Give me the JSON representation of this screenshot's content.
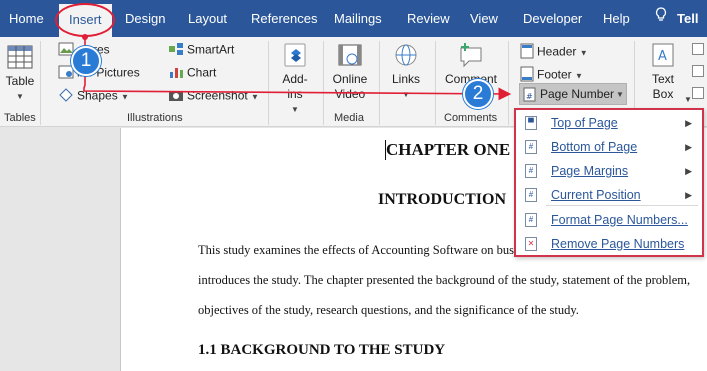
{
  "tabs": [
    "Home",
    "Insert",
    "Design",
    "Layout",
    "References",
    "Mailings",
    "Review",
    "View",
    "Developer",
    "Help"
  ],
  "active_tab": "Insert",
  "tell_me": "Tell m",
  "ribbon": {
    "table_label": "Table",
    "tables_group": "Tables",
    "illustrations": {
      "pictures": "ctures",
      "online_pictures": "ine Pictures",
      "shapes": "Shapes",
      "smartart": "SmartArt",
      "chart": "Chart",
      "screenshot": "Screenshot",
      "group": "Illustrations"
    },
    "addins": "Add-ins",
    "online_video": "Online Video",
    "media_group": "Media",
    "links": "Links",
    "comment": "Comment",
    "comments_group": "Comments",
    "header": "Header",
    "footer": "Footer",
    "page_number": "Page Number",
    "textbox": "Text Box"
  },
  "document": {
    "chapter_title": "CHAPTER ONE",
    "intro_title": "INTRODUCTION",
    "para_lines": [
      "This study examines the effects of Accounting Software on bus",
      "introduces the study. The chapter presented the background of the study, statement of the problem,",
      "objectives of the study, research questions, and the significance of the study."
    ],
    "section_heading": "1.1 BACKGROUND TO THE STUDY"
  },
  "menu_items": [
    {
      "label": "Top of Page",
      "submenu": true,
      "icon": "page-top-icon"
    },
    {
      "label": "Bottom of Page",
      "submenu": true,
      "icon": "page-bottom-icon"
    },
    {
      "label": "Page Margins",
      "submenu": true,
      "icon": "page-margins-icon"
    },
    {
      "label": "Current Position",
      "submenu": true,
      "icon": "current-position-icon"
    },
    {
      "label": "Format Page Numbers...",
      "submenu": false,
      "icon": "format-page-numbers-icon"
    },
    {
      "label": "Remove Page Numbers",
      "submenu": false,
      "icon": "remove-page-numbers-icon"
    }
  ],
  "annotations": {
    "step1": "1",
    "step2": "2"
  },
  "colors": {
    "brand": "#2b579a",
    "annotation_red": "#e01e35",
    "badge_blue": "#2a7bd5"
  }
}
